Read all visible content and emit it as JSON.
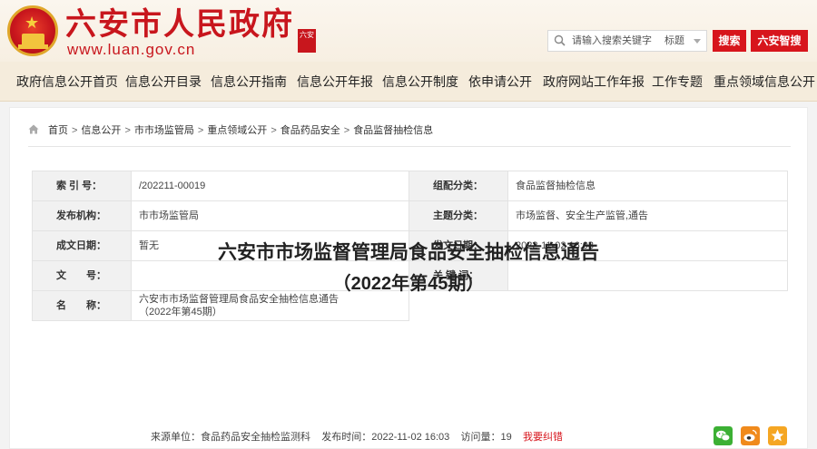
{
  "header": {
    "site_title": "六安市人民政府",
    "site_url": "www.luan.gov.cn",
    "seal_text": "六安",
    "search_placeholder": "请输入搜索关键字",
    "search_scope": "标题",
    "search_button": "搜索",
    "smart_button": "六安智搜"
  },
  "nav": {
    "items": [
      "政府信息公开首页",
      "信息公开目录",
      "信息公开指南",
      "信息公开年报",
      "信息公开制度",
      "依申请公开",
      "政府网站工作年报",
      "工作专题",
      "重点领域信息公开"
    ]
  },
  "breadcrumb": {
    "items": [
      "首页",
      "信息公开",
      "市市场监管局",
      "重点领域公开",
      "食品药品安全",
      "食品监督抽检信息"
    ],
    "separator": ">"
  },
  "meta": {
    "index_label": "索 引 号：",
    "index_value": "/202211-00019",
    "category_label": "组配分类：",
    "category_value": "食品监督抽检信息",
    "publisher_label": "发布机构：",
    "publisher_value": "市市场监管局",
    "topic_label": "主题分类：",
    "topic_value": "市场监督、安全生产监管,通告",
    "created_label": "成文日期：",
    "created_value": "暂无",
    "published_label": "发文日期：",
    "published_value": "2022-11-02 16:03",
    "docno_label": "文　　号：",
    "docno_value": "",
    "keywords_label": "关 键 词：",
    "keywords_value": "",
    "name_label": "名　　称：",
    "name_value_line1": "六安市市场监督管理局食品安全抽检信息通告",
    "name_value_line2": "（2022年第45期）"
  },
  "document": {
    "title": "六安市市场监督管理局食品安全抽检信息通告",
    "subtitle": "（2022年第45期）",
    "source_label": "来源单位：",
    "source_value": "食品药品安全抽检监测科",
    "time_label": "发布时间：",
    "time_value": "2022-11-02 16:03",
    "visits_label": "访问量：",
    "visits_value": "19",
    "error_link": "我要纠错"
  },
  "colors": {
    "brand_red": "#c8161d",
    "nav_bg": "#f5ecdc",
    "button_red": "#d7151c",
    "wechat_green": "#3cb034",
    "weibo_orange": "#f08a1c",
    "favorite_yellow": "#f5a623"
  },
  "icons": {
    "emblem": "national-emblem",
    "search": "search-icon",
    "home": "home-icon",
    "wechat": "wechat-icon",
    "weibo": "weibo-icon",
    "favorite": "star-icon"
  }
}
